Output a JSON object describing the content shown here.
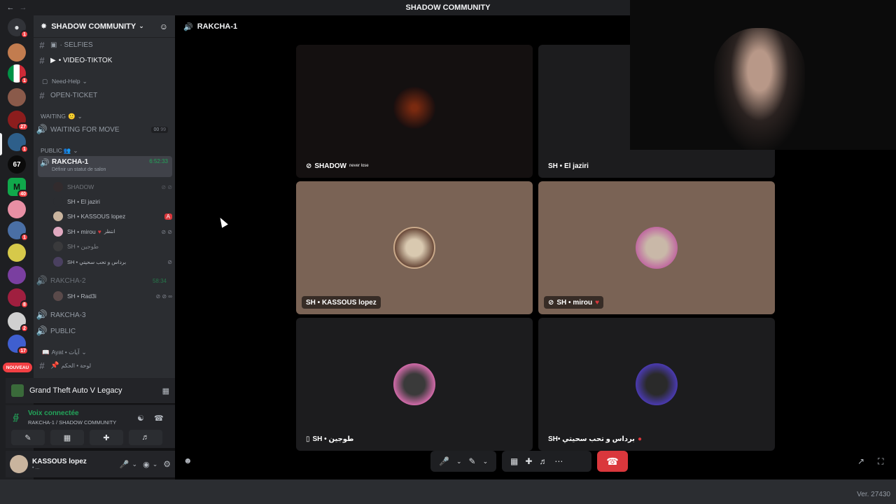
{
  "titlebar": {
    "title": "SHADOW COMMUNITY"
  },
  "server_badges": {
    "b1": "1",
    "b2": "1",
    "b3": "27",
    "b4": "1",
    "b5": "40",
    "b6": "1",
    "b7": "8",
    "b8": "2",
    "b9": "17"
  },
  "nouveau_label": "NOUVEAU",
  "sidebar": {
    "guild_name": "SHADOW COMMUNITY",
    "channels": {
      "selfies": "· SELFIES",
      "video_tiktok": "• VIDEO-TIKTOK",
      "need_help_cat": "Need-Help",
      "open_ticket": "OPEN-TICKET",
      "waiting_cat": "WAITING",
      "waiting_for_move": "WAITING FOR MOVE",
      "waiting_limit_a": "00",
      "waiting_limit_b": "99",
      "public_cat": "PUBLIC",
      "rakcha1": "RAKCHA-1",
      "rakcha1_timer": "6:52:33",
      "rakcha1_status": "Définir un statut de salon",
      "rakcha2": "RAKCHA-2",
      "rakcha2_timer": "58:34",
      "rakcha3": "RAKCHA-3",
      "public": "PUBLIC",
      "ayat_cat": "Ayat • آيات",
      "lawha": "لوحة • الحكم"
    },
    "members": {
      "m1": "SHADOW",
      "m2": "SH • El jaziri",
      "m3": "SH • KASSOUS lopez",
      "m4": "SH • mirou",
      "m4_extra": "انتظر",
      "m5": "SH • طوجين",
      "m6": "SH • برداس و تحب سحيتي",
      "m7": "SH • Rad3i"
    },
    "game_activity": "Grand Theft Auto V Legacy",
    "voice": {
      "status": "Voix connectée",
      "location": "RAKCHA-1 / SHADOW COMMUNITY"
    },
    "user": {
      "name": "KASSOUS lopez",
      "status": "• ..."
    }
  },
  "stage": {
    "channel_title": "RAKCHA-1",
    "tiles": [
      {
        "label": "SHADOW",
        "suffix": "never lose"
      },
      {
        "label": "SH • El jaziri"
      },
      {
        "label": "SH • KASSOUS lopez"
      },
      {
        "label": "SH • mirou"
      },
      {
        "label": "SH • طوجين"
      },
      {
        "label": "SH• برداس و تحب سحيتي"
      }
    ]
  },
  "colors": {
    "accent_green": "#23a55a",
    "danger": "#da373c",
    "tile_bg_dark": "#1c1c1e",
    "tile_bg_tan": "#7a6355"
  },
  "footer": {
    "version": "Ver. 27430"
  }
}
